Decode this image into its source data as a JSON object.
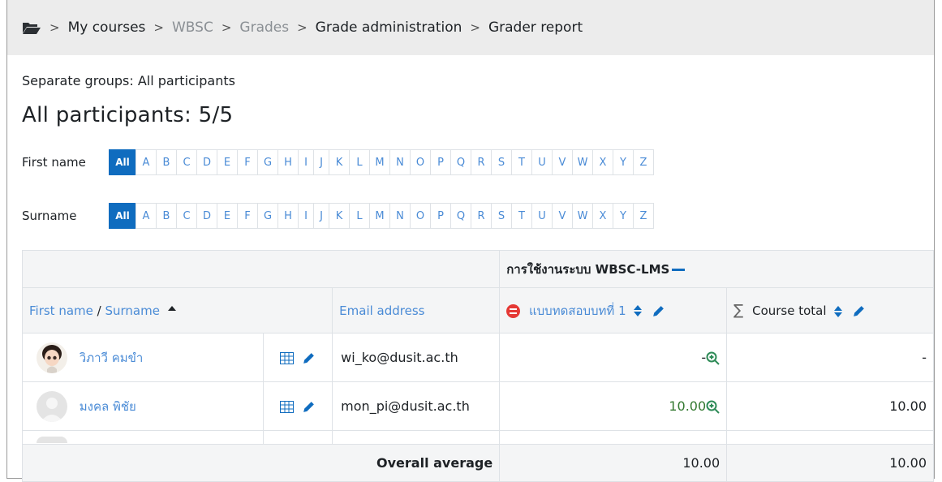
{
  "breadcrumb": [
    {
      "label": "My courses",
      "muted": false
    },
    {
      "label": "WBSC",
      "muted": true
    },
    {
      "label": "Grades",
      "muted": true
    },
    {
      "label": "Grade administration",
      "muted": false
    },
    {
      "label": "Grader report",
      "muted": false
    }
  ],
  "group_selector": {
    "text": "Separate groups: All participants"
  },
  "heading": "All participants: 5/5",
  "filters": {
    "first_name_label": "First name",
    "surname_label": "Surname",
    "all_label": "All",
    "letters": [
      "A",
      "B",
      "C",
      "D",
      "E",
      "F",
      "G",
      "H",
      "I",
      "J",
      "K",
      "L",
      "M",
      "N",
      "O",
      "P",
      "Q",
      "R",
      "S",
      "T",
      "U",
      "V",
      "W",
      "X",
      "Y",
      "Z"
    ]
  },
  "table": {
    "category_title": "การใช้งานระบบ WBSC-LMS",
    "col_first_name": "First name",
    "col_surname": "Surname",
    "col_email": "Email address",
    "col_quiz": "แบบทดสอบบทที่ 1",
    "col_total": "Course total",
    "rows": [
      {
        "name": "วิภาวี คมขำ",
        "email": "wi_ko@dusit.ac.th",
        "quiz": "-",
        "total": "-"
      },
      {
        "name": "มงคล พิชัย",
        "email": "mon_pi@dusit.ac.th",
        "quiz": "10.00",
        "total": "10.00"
      }
    ],
    "average": {
      "label": "Overall average",
      "quiz": "10.00",
      "total": "10.00"
    }
  },
  "icons": {
    "folder": "folder-open-icon",
    "sort_asc": "sort-asc-icon",
    "sort": "sort-icon",
    "edit": "pencil-icon",
    "grid": "table-icon",
    "zoom": "zoom-in-icon",
    "sigma": "sigma-icon",
    "quiz": "quiz-icon"
  },
  "colors": {
    "accent": "#0f6cbf",
    "link": "#4a8bd6",
    "grade_pass": "#357a32",
    "quiz_icon": "#e53935"
  }
}
